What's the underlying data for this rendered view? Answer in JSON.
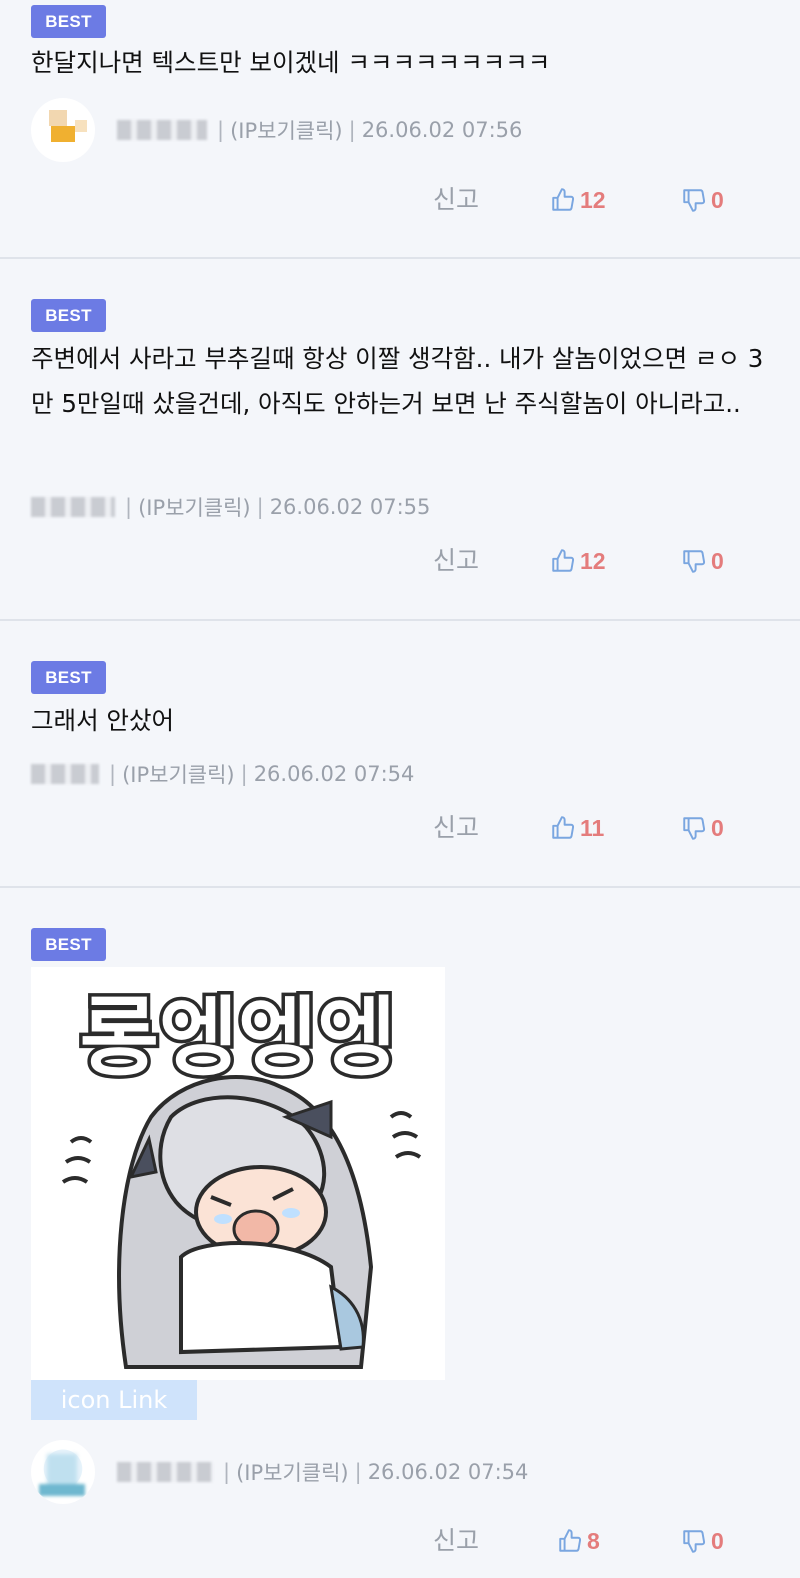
{
  "comments": [
    {
      "badge": "BEST",
      "text": "한달지나면 텍스트만 보이겠네 ㅋㅋㅋㅋㅋㅋㅋㅋㅋ",
      "ip": "(IP보기클릭)",
      "date": "26.06.02 07:56",
      "report": "신고",
      "likes": "12",
      "dislikes": "0"
    },
    {
      "badge": "BEST",
      "text": "주변에서 사라고 부추길때 항상 이짤 생각함.. 내가 살놈이었으면 ㄹㅇ 3만 5만일때 샀을건데, 아직도 안하는거 보면 난 주식할놈이 아니라고..",
      "ip": "(IP보기클릭)",
      "date": "26.06.02 07:55",
      "report": "신고",
      "likes": "12",
      "dislikes": "0"
    },
    {
      "badge": "BEST",
      "text": "그래서 안샀어",
      "ip": "(IP보기클릭)",
      "date": "26.06.02 07:54",
      "report": "신고",
      "likes": "11",
      "dislikes": "0"
    },
    {
      "badge": "BEST",
      "sticker_text": "롱엥엥엥",
      "icon_link": "icon Link",
      "ip": "(IP보기클릭)",
      "date": "26.06.02 07:54",
      "report": "신고",
      "likes": "8",
      "dislikes": "0"
    }
  ],
  "icons": {
    "like": "thumbs-up-icon",
    "dislike": "thumbs-down-icon"
  },
  "colors": {
    "badge": "#6c7be4",
    "count": "#e47c7c",
    "meta": "#9aa0aa",
    "thumb_icon": "#7aa6e0"
  }
}
